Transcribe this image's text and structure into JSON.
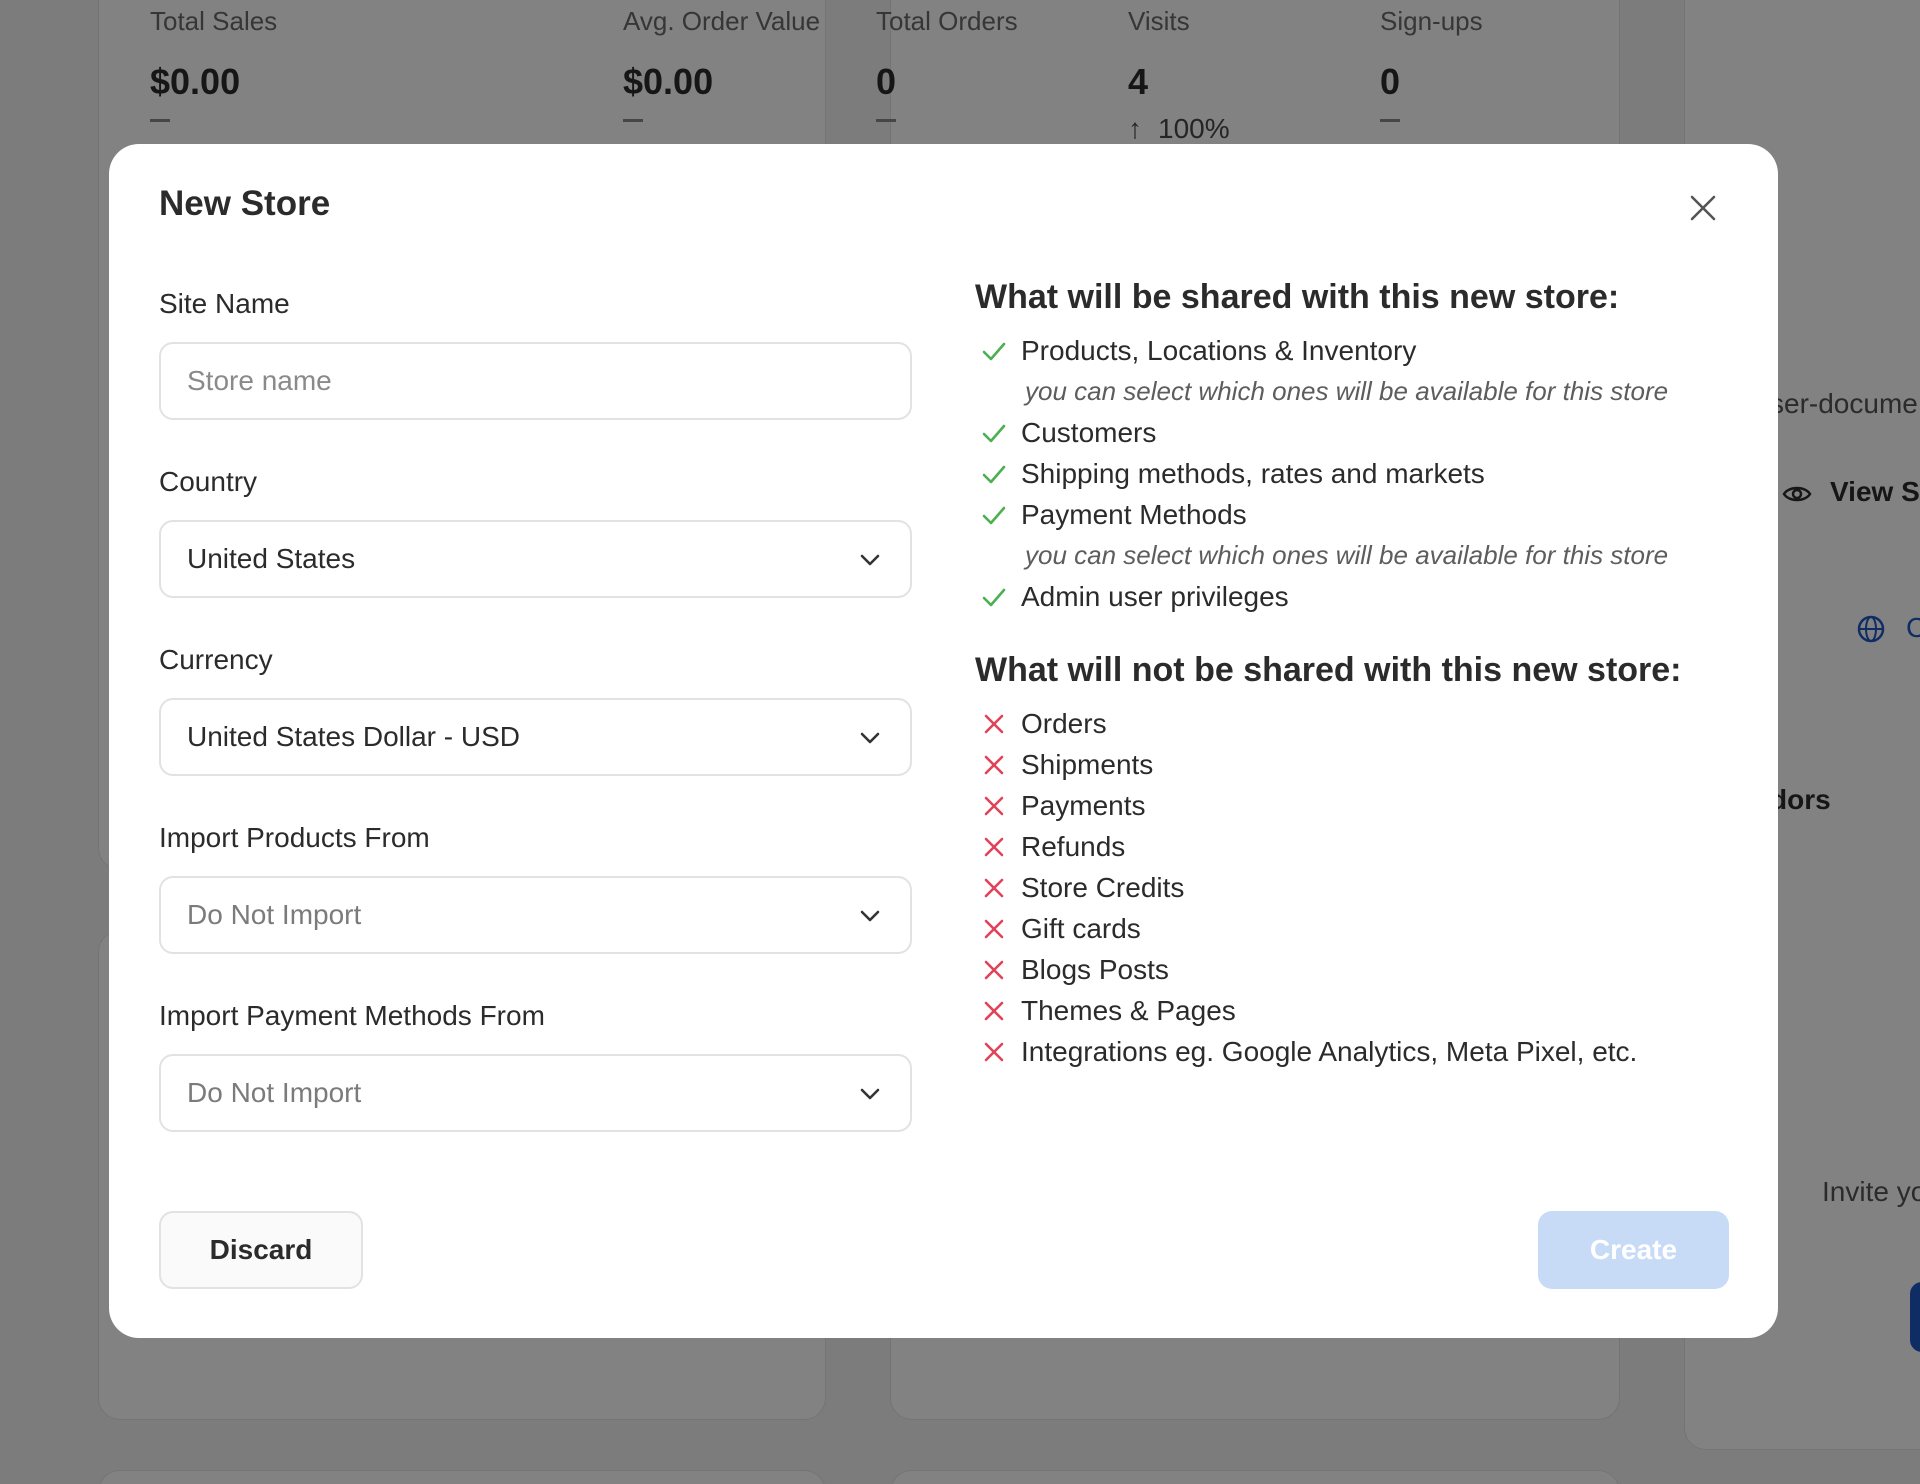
{
  "dashboard": {
    "stats": [
      {
        "label": "Total Sales",
        "value": "$0.00"
      },
      {
        "label": "Avg. Order Value",
        "value": "$0.00"
      },
      {
        "label": "Total Orders",
        "value": "0"
      },
      {
        "label": "Visits",
        "value": "4",
        "trend": "100%"
      },
      {
        "label": "Sign-ups",
        "value": "0"
      }
    ],
    "right_snippets": [
      "ser-docume",
      "View S",
      "C",
      "dors",
      "Invite yo"
    ]
  },
  "modal": {
    "title": "New Store",
    "fields": {
      "site_name": {
        "label": "Site Name",
        "placeholder": "Store name",
        "value": ""
      },
      "country": {
        "label": "Country",
        "value": "United States"
      },
      "currency": {
        "label": "Currency",
        "value": "United States Dollar - USD"
      },
      "import_products": {
        "label": "Import Products From",
        "value": "Do Not Import"
      },
      "import_payments": {
        "label": "Import Payment Methods From",
        "value": "Do Not Import"
      }
    },
    "shared": {
      "heading": "What will be shared with this new store:",
      "items": [
        "Products, Locations & Inventory",
        "you can select which ones will be available for this store",
        "Customers",
        "Shipping methods, rates and markets",
        "Payment Methods",
        "you can select which ones will be available for this store",
        "Admin user privileges"
      ]
    },
    "not_shared": {
      "heading": "What will not be shared with this new store:",
      "items": [
        "Orders",
        "Shipments",
        "Payments",
        "Refunds",
        "Store Credits",
        "Gift cards",
        "Blogs Posts",
        "Themes & Pages",
        "Integrations eg. Google Analytics, Meta Pixel, etc."
      ]
    },
    "buttons": {
      "discard": "Discard",
      "create": "Create"
    },
    "colors": {
      "check": "#4caf50",
      "cross": "#e0435a",
      "create_bg": "#c8dbf6"
    }
  }
}
